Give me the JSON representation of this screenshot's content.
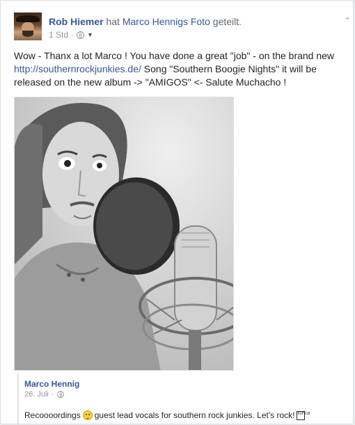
{
  "post": {
    "author": "Rob Hiemer",
    "share_prefix": "hat",
    "shared_from": "Marco Hennigs",
    "shared_object": "Foto",
    "share_suffix": "geteilt.",
    "time": "1 Std",
    "separator": "·",
    "audience_icon": "globe-icon",
    "menu_icon": "chevron-down-icon",
    "text_part1": "Wow - Thanx a lot Marco ! You have done a great \"job\" - on the brand new ",
    "text_link": "http://southernrockjunkies.de/",
    "text_part2": " Song \"Southern Boogie Nights\" it will be released on the new album -> \"AMIGOS\" <- Salute Muchacho !"
  },
  "photo": {
    "description_icon": "studio-photo"
  },
  "shared": {
    "author": "Marco Hennig",
    "date": "26. Juli",
    "separator": "·",
    "text_before": "Recoooordings",
    "emoji_icon": "grinning-face-icon",
    "text_after": "guest lead vocals for southern rock junkies. Let's rock!",
    "tofu_icon": "unknown-glyph-icon",
    "tofu_text": "01F918"
  },
  "colors": {
    "link": "#365899",
    "meta": "#90949c",
    "text": "#1d2129"
  }
}
